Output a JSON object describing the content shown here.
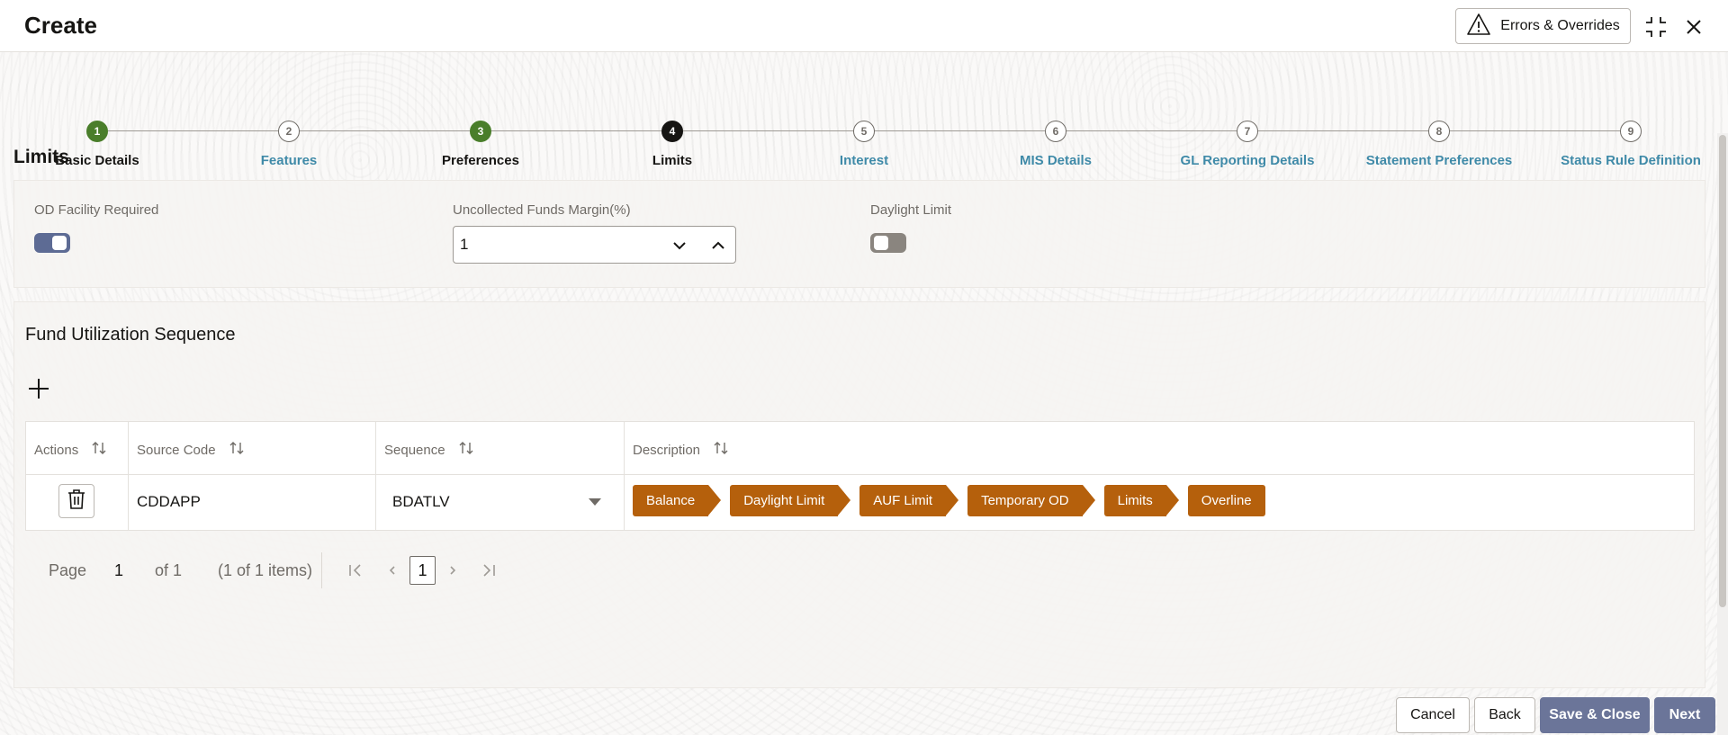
{
  "header": {
    "title": "Create",
    "errors_button_label": "Errors & Overrides"
  },
  "stepper": {
    "steps": [
      {
        "number": "1",
        "label": "Basic Details",
        "state": "done"
      },
      {
        "number": "2",
        "label": "Features",
        "state": "pending"
      },
      {
        "number": "3",
        "label": "Preferences",
        "state": "done"
      },
      {
        "number": "4",
        "label": "Limits",
        "state": "active"
      },
      {
        "number": "5",
        "label": "Interest",
        "state": "pending"
      },
      {
        "number": "6",
        "label": "MIS Details",
        "state": "pending"
      },
      {
        "number": "7",
        "label": "GL Reporting Details",
        "state": "pending"
      },
      {
        "number": "8",
        "label": "Statement Preferences",
        "state": "pending"
      },
      {
        "number": "9",
        "label": "Status Rule Definition",
        "state": "pending"
      }
    ]
  },
  "limits": {
    "section_title": "Limits",
    "od_facility": {
      "label": "OD Facility Required",
      "on": true
    },
    "uncollected_margin": {
      "label": "Uncollected Funds Margin(%)",
      "value": "1"
    },
    "daylight_limit": {
      "label": "Daylight Limit",
      "on": false
    }
  },
  "fund_utilization": {
    "title": "Fund Utilization Sequence",
    "columns": [
      "Actions",
      "Source Code",
      "Sequence",
      "Description"
    ],
    "rows": [
      {
        "source_code": "CDDAPP",
        "sequence": "BDATLV",
        "description": [
          "Balance",
          "Daylight Limit",
          "AUF Limit",
          "Temporary OD",
          "Limits",
          "Overline"
        ]
      }
    ]
  },
  "pagination": {
    "page_label": "Page",
    "page_value": "1",
    "of_label": "of 1",
    "items_label": "(1 of 1 items)",
    "current_page": "1"
  },
  "footer": {
    "cancel": "Cancel",
    "back": "Back",
    "save_close": "Save & Close",
    "next": "Next"
  },
  "colors": {
    "done_step": "#4a7e2b",
    "active_step": "#161513",
    "link_step": "#3f8aa8",
    "chip": "#b5600c",
    "primary_button": "#6b7599"
  }
}
